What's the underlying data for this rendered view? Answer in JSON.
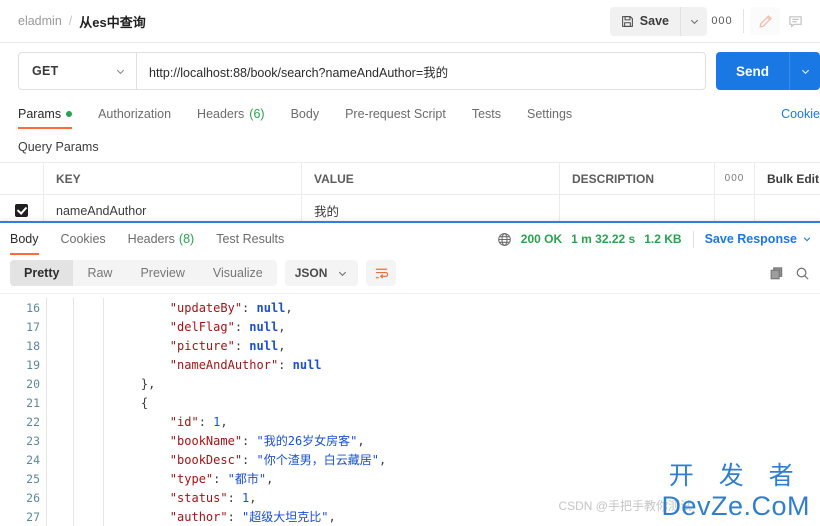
{
  "header": {
    "breadcrumb_root": "eladmin",
    "breadcrumb_sep": "/",
    "breadcrumb_current": "从es中查询",
    "save_label": "Save",
    "more_label": "000"
  },
  "request": {
    "method": "GET",
    "url": "http://localhost:88/book/search?nameAndAuthor=我的",
    "send_label": "Send",
    "tabs": [
      {
        "label": "Params",
        "badge": "",
        "dot": true,
        "active": true
      },
      {
        "label": "Authorization",
        "badge": "",
        "dot": false,
        "active": false
      },
      {
        "label": "Headers",
        "badge": "(6)",
        "dot": false,
        "active": false
      },
      {
        "label": "Body",
        "badge": "",
        "dot": false,
        "active": false
      },
      {
        "label": "Pre-request Script",
        "badge": "",
        "dot": false,
        "active": false
      },
      {
        "label": "Tests",
        "badge": "",
        "dot": false,
        "active": false
      },
      {
        "label": "Settings",
        "badge": "",
        "dot": false,
        "active": false
      }
    ],
    "cookie_link": "Cookie"
  },
  "query_params": {
    "title": "Query Params",
    "columns": {
      "key": "KEY",
      "value": "VALUE",
      "description": "DESCRIPTION",
      "dots": "000",
      "bulk_edit": "Bulk Edit"
    },
    "rows": [
      {
        "checked": true,
        "key": "nameAndAuthor",
        "value": "我的",
        "description": ""
      }
    ]
  },
  "response": {
    "tabs": [
      {
        "label": "Body",
        "badge": "",
        "active": true
      },
      {
        "label": "Cookies",
        "badge": "",
        "active": false
      },
      {
        "label": "Headers",
        "badge": "(8)",
        "active": false
      },
      {
        "label": "Test Results",
        "badge": "",
        "active": false
      }
    ],
    "status": "200 OK",
    "time": "1 m 32.22 s",
    "size": "1.2 KB",
    "save_response": "Save Response",
    "view_modes": [
      {
        "label": "Pretty",
        "active": true
      },
      {
        "label": "Raw",
        "active": false
      },
      {
        "label": "Preview",
        "active": false
      },
      {
        "label": "Visualize",
        "active": false
      }
    ],
    "format": "JSON",
    "code_lines": [
      {
        "num": "16",
        "indent": 8,
        "tokens": [
          {
            "t": "k",
            "s": "\"updateBy\""
          },
          {
            "t": "p",
            "s": ": "
          },
          {
            "t": "v-null",
            "s": "null"
          },
          {
            "t": "p",
            "s": ","
          }
        ]
      },
      {
        "num": "17",
        "indent": 8,
        "tokens": [
          {
            "t": "k",
            "s": "\"delFlag\""
          },
          {
            "t": "p",
            "s": ": "
          },
          {
            "t": "v-null",
            "s": "null"
          },
          {
            "t": "p",
            "s": ","
          }
        ]
      },
      {
        "num": "18",
        "indent": 8,
        "tokens": [
          {
            "t": "k",
            "s": "\"picture\""
          },
          {
            "t": "p",
            "s": ": "
          },
          {
            "t": "v-null",
            "s": "null"
          },
          {
            "t": "p",
            "s": ","
          }
        ]
      },
      {
        "num": "19",
        "indent": 8,
        "tokens": [
          {
            "t": "k",
            "s": "\"nameAndAuthor\""
          },
          {
            "t": "p",
            "s": ": "
          },
          {
            "t": "v-null",
            "s": "null"
          }
        ]
      },
      {
        "num": "20",
        "indent": 4,
        "tokens": [
          {
            "t": "p",
            "s": "},"
          }
        ]
      },
      {
        "num": "21",
        "indent": 4,
        "tokens": [
          {
            "t": "p",
            "s": "{"
          }
        ]
      },
      {
        "num": "22",
        "indent": 8,
        "tokens": [
          {
            "t": "k",
            "s": "\"id\""
          },
          {
            "t": "p",
            "s": ": "
          },
          {
            "t": "v-num",
            "s": "1"
          },
          {
            "t": "p",
            "s": ","
          }
        ]
      },
      {
        "num": "23",
        "indent": 8,
        "tokens": [
          {
            "t": "k",
            "s": "\"bookName\""
          },
          {
            "t": "p",
            "s": ": "
          },
          {
            "t": "v-str",
            "s": "\"我的26岁女房客\""
          },
          {
            "t": "p",
            "s": ","
          }
        ]
      },
      {
        "num": "24",
        "indent": 8,
        "tokens": [
          {
            "t": "k",
            "s": "\"bookDesc\""
          },
          {
            "t": "p",
            "s": ": "
          },
          {
            "t": "v-str",
            "s": "\"你个渣男，白云藏居\""
          },
          {
            "t": "p",
            "s": ","
          }
        ]
      },
      {
        "num": "25",
        "indent": 8,
        "tokens": [
          {
            "t": "k",
            "s": "\"type\""
          },
          {
            "t": "p",
            "s": ": "
          },
          {
            "t": "v-str",
            "s": "\"都市\""
          },
          {
            "t": "p",
            "s": ","
          }
        ]
      },
      {
        "num": "26",
        "indent": 8,
        "tokens": [
          {
            "t": "k",
            "s": "\"status\""
          },
          {
            "t": "p",
            "s": ": "
          },
          {
            "t": "v-num",
            "s": "1"
          },
          {
            "t": "p",
            "s": ","
          }
        ]
      },
      {
        "num": "27",
        "indent": 8,
        "tokens": [
          {
            "t": "k",
            "s": "\"author\""
          },
          {
            "t": "p",
            "s": ": "
          },
          {
            "t": "v-str",
            "s": "\"超级大坦克比\""
          },
          {
            "t": "p",
            "s": ","
          }
        ]
      }
    ]
  },
  "watermarks": {
    "csdn": "CSDN @手把手教你测试",
    "dev_line1": "开 发 者",
    "dev_line2": "DevZe.CoM"
  },
  "colors": {
    "accent_orange": "#ff6c37",
    "send_blue": "#1a78e5",
    "status_green": "#2aa350",
    "link_blue": "#1a78e5",
    "divider_blue": "#2f7fe0"
  }
}
